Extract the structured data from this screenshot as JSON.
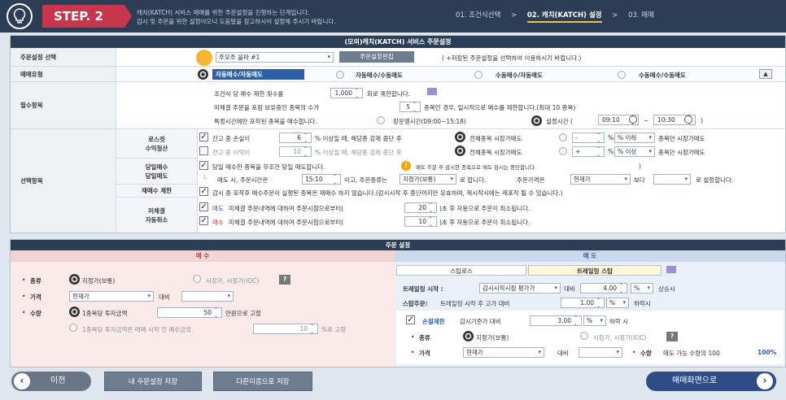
{
  "header": {
    "step": "STEP. 2",
    "desc1": "캐치(KATCH) 서비스 매매를 위한 주문설정을 진행하는 단계입니다.",
    "desc2": "감시 및 주문을 위한 설정이오니 도움말을 참고하시어 설정해 주시기 바랍니다.",
    "steps": [
      "01. 조건식선택",
      ">",
      "02. 캐치(KATCH) 설정",
      ">",
      "03. 매매"
    ]
  },
  "panel": {
    "title": "(모의)캐치(KATCH) 서비스 주문설정",
    "row1": {
      "label": "주문설정 선택",
      "select": "주모주 을파 #1",
      "btn": "주문설정편집",
      "note": "( +저장된 주문설정을 선택하여 이용하시기 바랍니다.)"
    },
    "row2": {
      "label": "매매유형",
      "opt1": "자동매수/자동매도",
      "opt2": "자동매수/수동매도",
      "opt3": "수동매수/자동매도",
      "opt4": "수동매수/수동매도",
      "arrow": "▲"
    },
    "row3": {
      "label": "필수항목",
      "l1a": "조건식 당 매수 제한 횟수를",
      "l1v": "1,000",
      "l1b": "회로 제한합니다.",
      "l2a": "미체결 주문을 포함 보유중인 종목의 수가",
      "l2v": "5",
      "l2b": "종목인 경우, 일시적으로 매수를 제한합니다.(최대 10 종목)",
      "l3a": "특정시간에만 포착된 종목을 매수합니다.",
      "l3b": "장운영시간(09:00~15:18)",
      "l3c": "설정시간 (",
      "t1": "09:10",
      "t2": "10:30",
      "tilde": "~",
      ")": ")"
    },
    "row4": {
      "label": "선택항목",
      "sub1": "로스컷\n수익청산",
      "sub2": "당일매수\n당일매도",
      "sub3": "재매수 제한",
      "sub4": "미체결\n자동취소",
      "a1": "잔고 중 손실이",
      "a1v": "6",
      "a1b": "% 이상일 때, 해당종 강제 중단 후",
      "a1c": "전체종목 시장가매도",
      "a1d": "-",
      "a1e": "% 이하",
      "a1f": "종목만 시장가매도",
      "a2": "잔고 중 이익이",
      "a2v": "10",
      "a2b": "% 이상일 때, 해당종 강제 중단 후",
      "a2c": "전체종목 시장가매도",
      "a2d": "+",
      "a2e": "% 이상",
      "a2f": "종목만 시장가매도",
      "b1": "당일 매수한 종목을 무조건 당일 매도합니다.",
      "b1n": "매도 주문 후 감시한 종목으로 매도 감시는 중단합니다.",
      "b1p": ")",
      "b2": "매도 시, 주문시간은",
      "b2v": "15:10",
      "b2b": "이고, 주문종류는",
      "b2c": "지정가(보통)",
      "b2d": "로 합니다.",
      "b2e": "주문가격은",
      "b2f": "현재가",
      "b2g": "보다",
      "b2h": "",
      "b2i": "로 설정합니다.",
      "c1": "감시 중 포착후 매수주문이 실행된 종목은 재매수 하지 않습니다.(감시시작 후 중단까지만 유효하며, 재시작시에는 재포착 될 수 있습니다.)",
      "d1a": "매도",
      "d1": "미체결 주문내역에 대하여 주문시점으로부터(",
      "d1v": "20",
      "d1b": ")초 후 자동으로 주문이 취소됩니다.",
      "d2a": "매수",
      "d2": "미체결 주문내역에 대하여 주문시점으로부터(",
      "d2v": "10",
      "d2b": ")초 후 자동으로 주문이 취소됩니다."
    }
  },
  "order": {
    "title": "주문 설정",
    "buy": {
      "title": "매 수",
      "kind": "종류",
      "kind1": "지정가(보통)",
      "kind2": "시장가, 시장가(IOC)",
      "q": "?",
      "price": "가격",
      "price_sel": "현재가",
      "vs": "대비",
      "qty": "수량",
      "qty1": "1종목당 투자금액",
      "qty1v": "50",
      "qty1b": "만원으로 고정",
      "qty2": "1종목당 투자금액은 매매 시작 전 예수금의",
      "qty2v": "10",
      "qty2b": "%로 고정"
    },
    "sell": {
      "title": "매 도",
      "tab1": "스탑로스",
      "tab2": "트레일링 스탑",
      "trail_start": "트레일링 시작 :",
      "trail_sel": "감시시작시점 평가가",
      "vs": "대비",
      "trail_v": "4.00",
      "pct": "%",
      "up": "상승시",
      "stop": "스탑주문:",
      "stop_txt": "트레일링 시작 후 고가 대비",
      "stop_v": "1.00",
      "down": "하락시",
      "loss": "손절제한",
      "loss_txt": "감시기준가 대비",
      "loss_v": "3.00",
      "loss_down": "하락 시",
      "kind": "종류",
      "kind1": "지정가(보통)",
      "kind2": "시장가, 시장가(IOC)",
      "q": "?",
      "price": "가격",
      "price_sel": "현재가",
      "vs2": "대비",
      "qty": "수량",
      "qty_txt": "매도 가능 수량의 100",
      "qty_pct": "100%"
    }
  },
  "footer": {
    "prev": "이전",
    "save": "내 주문설정 저장",
    "save_as": "다른이름으로 저장",
    "next": "매매화면으로"
  }
}
